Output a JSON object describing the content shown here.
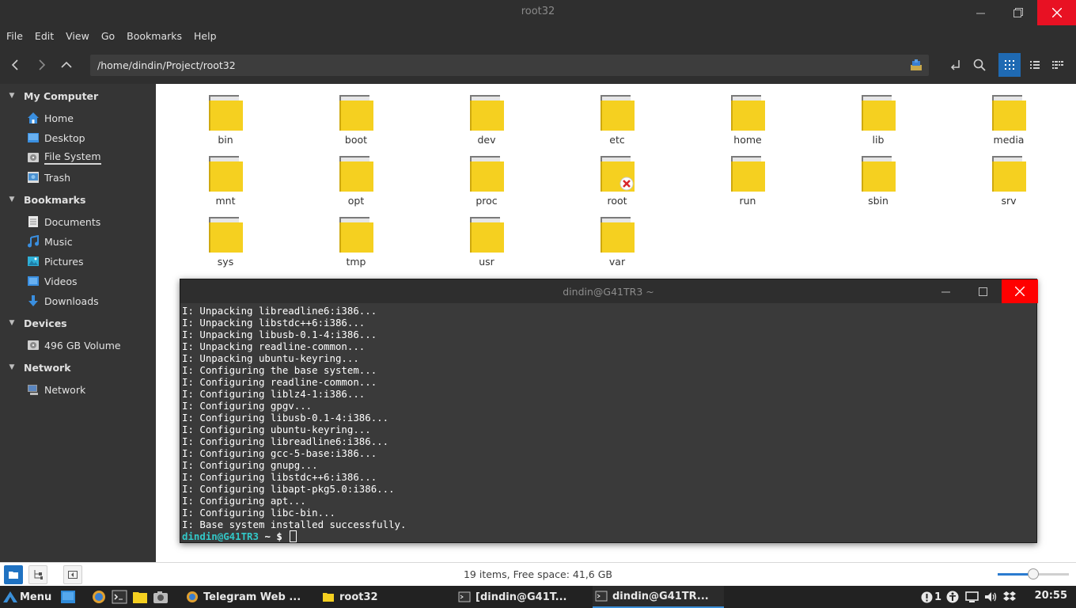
{
  "window": {
    "title": "root32"
  },
  "menu": [
    "File",
    "Edit",
    "View",
    "Go",
    "Bookmarks",
    "Help"
  ],
  "toolbar": {
    "path": "/home/dindin/Project/root32"
  },
  "sidebar": {
    "sections": [
      {
        "label": "My Computer",
        "items": [
          {
            "label": "Home",
            "icon": "home-icon"
          },
          {
            "label": "Desktop",
            "icon": "desktop-icon"
          },
          {
            "label": "File System",
            "icon": "drive-icon",
            "active": true
          },
          {
            "label": "Trash",
            "icon": "trash-icon"
          }
        ]
      },
      {
        "label": "Bookmarks",
        "items": [
          {
            "label": "Documents",
            "icon": "documents-icon"
          },
          {
            "label": "Music",
            "icon": "music-icon"
          },
          {
            "label": "Pictures",
            "icon": "pictures-icon"
          },
          {
            "label": "Videos",
            "icon": "videos-icon"
          },
          {
            "label": "Downloads",
            "icon": "downloads-icon"
          }
        ]
      },
      {
        "label": "Devices",
        "items": [
          {
            "label": "496 GB Volume",
            "icon": "drive-icon"
          }
        ]
      },
      {
        "label": "Network",
        "items": [
          {
            "label": "Network",
            "icon": "network-icon"
          }
        ]
      }
    ]
  },
  "folders": [
    "bin",
    "boot",
    "dev",
    "etc",
    "home",
    "lib",
    "media",
    "mnt",
    "opt",
    "proc",
    "root",
    "run",
    "sbin",
    "srv",
    "sys",
    "tmp",
    "usr",
    "var"
  ],
  "locked_folder": "root",
  "terminal": {
    "title": "dindin@G41TR3 ~",
    "lines": [
      "I: Unpacking libreadline6:i386...",
      "I: Unpacking libstdc++6:i386...",
      "I: Unpacking libusb-0.1-4:i386...",
      "I: Unpacking readline-common...",
      "I: Unpacking ubuntu-keyring...",
      "I: Configuring the base system...",
      "I: Configuring readline-common...",
      "I: Configuring liblz4-1:i386...",
      "I: Configuring gpgv...",
      "I: Configuring libusb-0.1-4:i386...",
      "I: Configuring ubuntu-keyring...",
      "I: Configuring libreadline6:i386...",
      "I: Configuring gcc-5-base:i386...",
      "I: Configuring gnupg...",
      "I: Configuring libstdc++6:i386...",
      "I: Configuring libapt-pkg5.0:i386...",
      "I: Configuring apt...",
      "I: Configuring libc-bin...",
      "I: Base system installed successfully."
    ],
    "prompt_user": "dindin@G41TR3",
    "prompt_rest": " ~ $ "
  },
  "status": {
    "text": "19 items, Free space: 41,6 GB",
    "zoom_fraction": 0.5
  },
  "taskbar": {
    "menu_label": "Menu",
    "tasks": [
      {
        "label": "Telegram Web ...",
        "icon": "telegram-icon"
      },
      {
        "label": "root32",
        "icon": "folder-icon"
      },
      {
        "label": "[dindin@G41T...",
        "icon": "terminal-icon"
      },
      {
        "label": "dindin@G41TR...",
        "icon": "terminal-icon",
        "active": true
      }
    ],
    "notification_count": "1",
    "clock": "20:55"
  },
  "colors": {
    "accent": "#1f6ab3",
    "folder": "#f5d020",
    "close": "#e81123",
    "prompt": "#32c8c8"
  }
}
